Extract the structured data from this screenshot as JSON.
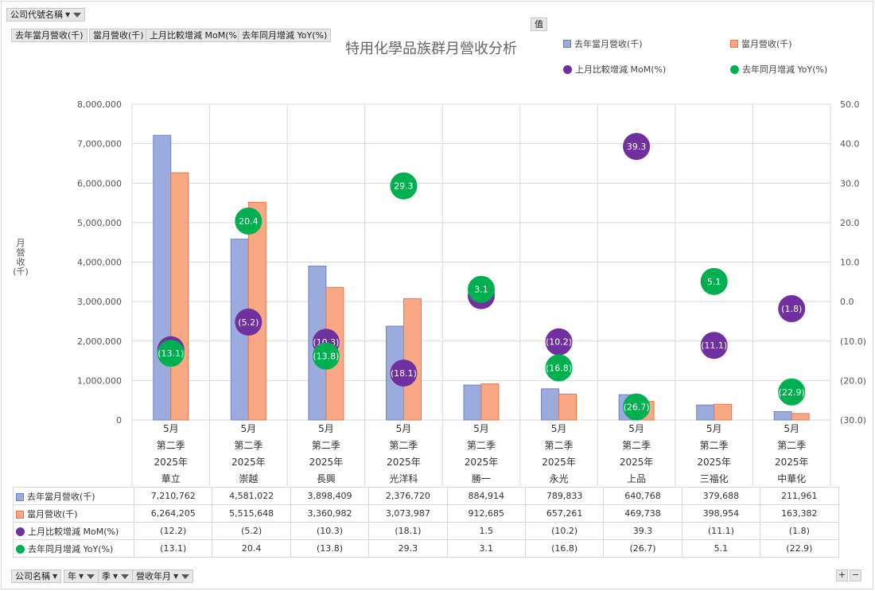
{
  "filters_top": {
    "company": "公司代號名稱",
    "value_label": "值"
  },
  "value_fields": [
    "去年當月營收(千)",
    "當月營收(千)",
    "上月比較增減 MoM(%)",
    "去年同月增減 YoY(%)"
  ],
  "bottom_fields": [
    "公司名稱",
    "年",
    "季",
    "營收年月"
  ],
  "colors": {
    "prev": "#9cabdd",
    "prev_edge": "#6f84c6",
    "curr": "#f8a883",
    "curr_edge": "#e07a4a",
    "mom": "#7030a0",
    "yoy": "#00b050",
    "grid": "#d9d9d9"
  },
  "chart_data": {
    "type": "bar",
    "title": "特用化學品族群月營收分析",
    "ylabel": "月營收(千)",
    "ylim": [
      0,
      8000000
    ],
    "y2lim": [
      -30,
      50
    ],
    "y_ticks": [
      "0",
      "1,000,000",
      "2,000,000",
      "3,000,000",
      "4,000,000",
      "5,000,000",
      "6,000,000",
      "7,000,000",
      "8,000,000"
    ],
    "y2_ticks": [
      "(30.0)",
      "(20.0)",
      "(10.0)",
      "0.0",
      "10.0",
      "20.0",
      "30.0",
      "40.0",
      "50.0"
    ],
    "categories": [
      {
        "month": "5月",
        "quarter": "第二季",
        "year": "2025年",
        "company": "華立"
      },
      {
        "month": "5月",
        "quarter": "第二季",
        "year": "2025年",
        "company": "崇越"
      },
      {
        "month": "5月",
        "quarter": "第二季",
        "year": "2025年",
        "company": "長興"
      },
      {
        "month": "5月",
        "quarter": "第二季",
        "year": "2025年",
        "company": "光洋科"
      },
      {
        "month": "5月",
        "quarter": "第二季",
        "year": "2025年",
        "company": "勝一"
      },
      {
        "month": "5月",
        "quarter": "第二季",
        "year": "2025年",
        "company": "永光"
      },
      {
        "month": "5月",
        "quarter": "第二季",
        "year": "2025年",
        "company": "上品"
      },
      {
        "month": "5月",
        "quarter": "第二季",
        "year": "2025年",
        "company": "三福化"
      },
      {
        "month": "5月",
        "quarter": "第二季",
        "year": "2025年",
        "company": "中華化"
      }
    ],
    "series": [
      {
        "name": "去年當月營收(千)",
        "kind": "bar",
        "values": [
          7210762,
          4581022,
          3898409,
          2376720,
          884914,
          789833,
          640768,
          379688,
          211961
        ],
        "labels": [
          "7,210,762",
          "4,581,022",
          "3,898,409",
          "2,376,720",
          "884,914",
          "789,833",
          "640,768",
          "379,688",
          "211,961"
        ]
      },
      {
        "name": "當月營收(千)",
        "kind": "bar",
        "values": [
          6264205,
          5515648,
          3360982,
          3073987,
          912685,
          657261,
          469738,
          398954,
          163382
        ],
        "labels": [
          "6,264,205",
          "5,515,648",
          "3,360,982",
          "3,073,987",
          "912,685",
          "657,261",
          "469,738",
          "398,954",
          "163,382"
        ]
      },
      {
        "name": "上月比較增減 MoM(%)",
        "kind": "bubble",
        "values": [
          -12.2,
          -5.2,
          -10.3,
          -18.1,
          1.5,
          -10.2,
          39.3,
          -11.1,
          -1.8
        ],
        "labels": [
          "(12.2)",
          "(5.2)",
          "(10.3)",
          "(18.1)",
          "1.5",
          "(10.2)",
          "39.3",
          "(11.1)",
          "(1.8)"
        ]
      },
      {
        "name": "去年同月增減 YoY(%)",
        "kind": "bubble",
        "values": [
          -13.1,
          20.4,
          -13.8,
          29.3,
          3.1,
          -16.8,
          -26.7,
          5.1,
          -22.9
        ],
        "labels": [
          "(13.1)",
          "20.4",
          "(13.8)",
          "29.3",
          "3.1",
          "(16.8)",
          "(26.7)",
          "5.1",
          "(22.9)"
        ]
      }
    ]
  }
}
